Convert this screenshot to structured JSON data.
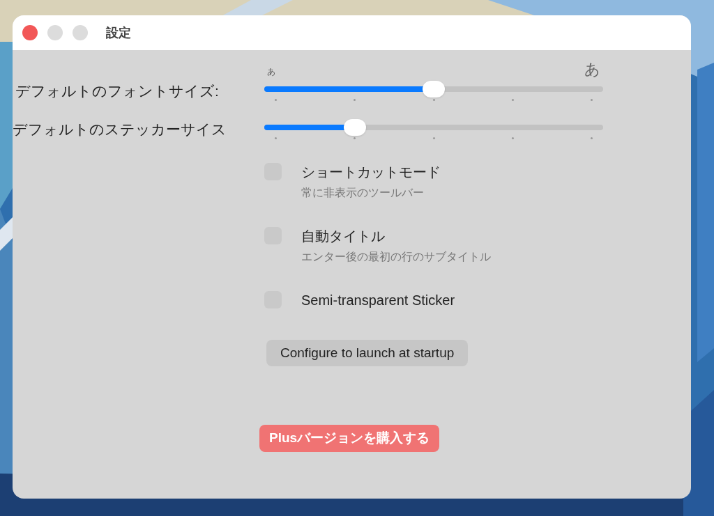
{
  "window": {
    "title": "設定"
  },
  "sliders": [
    {
      "label": "デフォルトのフォントサイズ:",
      "level": 0.5,
      "min_label": "あ",
      "max_label": "あ"
    },
    {
      "label": "デフォルトのステッカーサイス",
      "level": 0.25
    }
  ],
  "options": [
    {
      "title": "ショートカットモード",
      "subtitle": "常に非表示のツールバー",
      "checked": false
    },
    {
      "title": "自動タイトル",
      "subtitle": "エンター後の最初の行のサブタイトル",
      "checked": false
    },
    {
      "title": "Semi-transparent Sticker",
      "checked": false
    }
  ],
  "buttons": [
    {
      "label": "Configure to launch at startup",
      "kind": "plain"
    },
    {
      "label": "Plusバージョンを購入する",
      "kind": "accent"
    }
  ]
}
